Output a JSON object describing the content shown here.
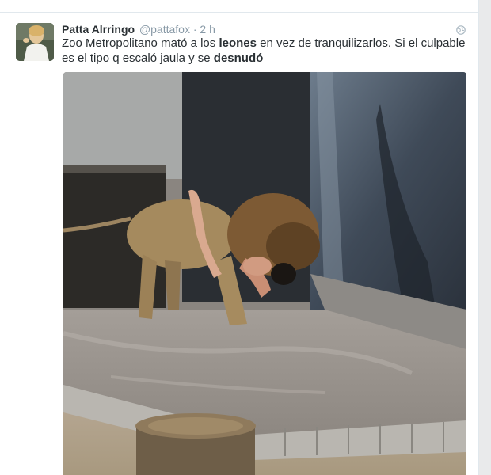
{
  "tweet": {
    "author_name": "Patta Alrringo",
    "author_handle": "@pattafox",
    "separator": "·",
    "timestamp": "2 h",
    "text_parts": [
      {
        "text": "Zoo Metropolitano mató a los ",
        "bold": false
      },
      {
        "text": "leones",
        "bold": true
      },
      {
        "text": " en vez de tranquilizarlos. Si el culpable es el tipo q escaló jaula y se ",
        "bold": false
      },
      {
        "text": "desnudó",
        "bold": true
      }
    ],
    "globe_icon": "globe-icon",
    "avatar_icon": "avatar",
    "media": "photo-lions-enclosure"
  },
  "colors": {
    "name": "#292f33",
    "meta": "#8899a6",
    "border": "#e1e8ed",
    "background": "#e9eaeb"
  }
}
